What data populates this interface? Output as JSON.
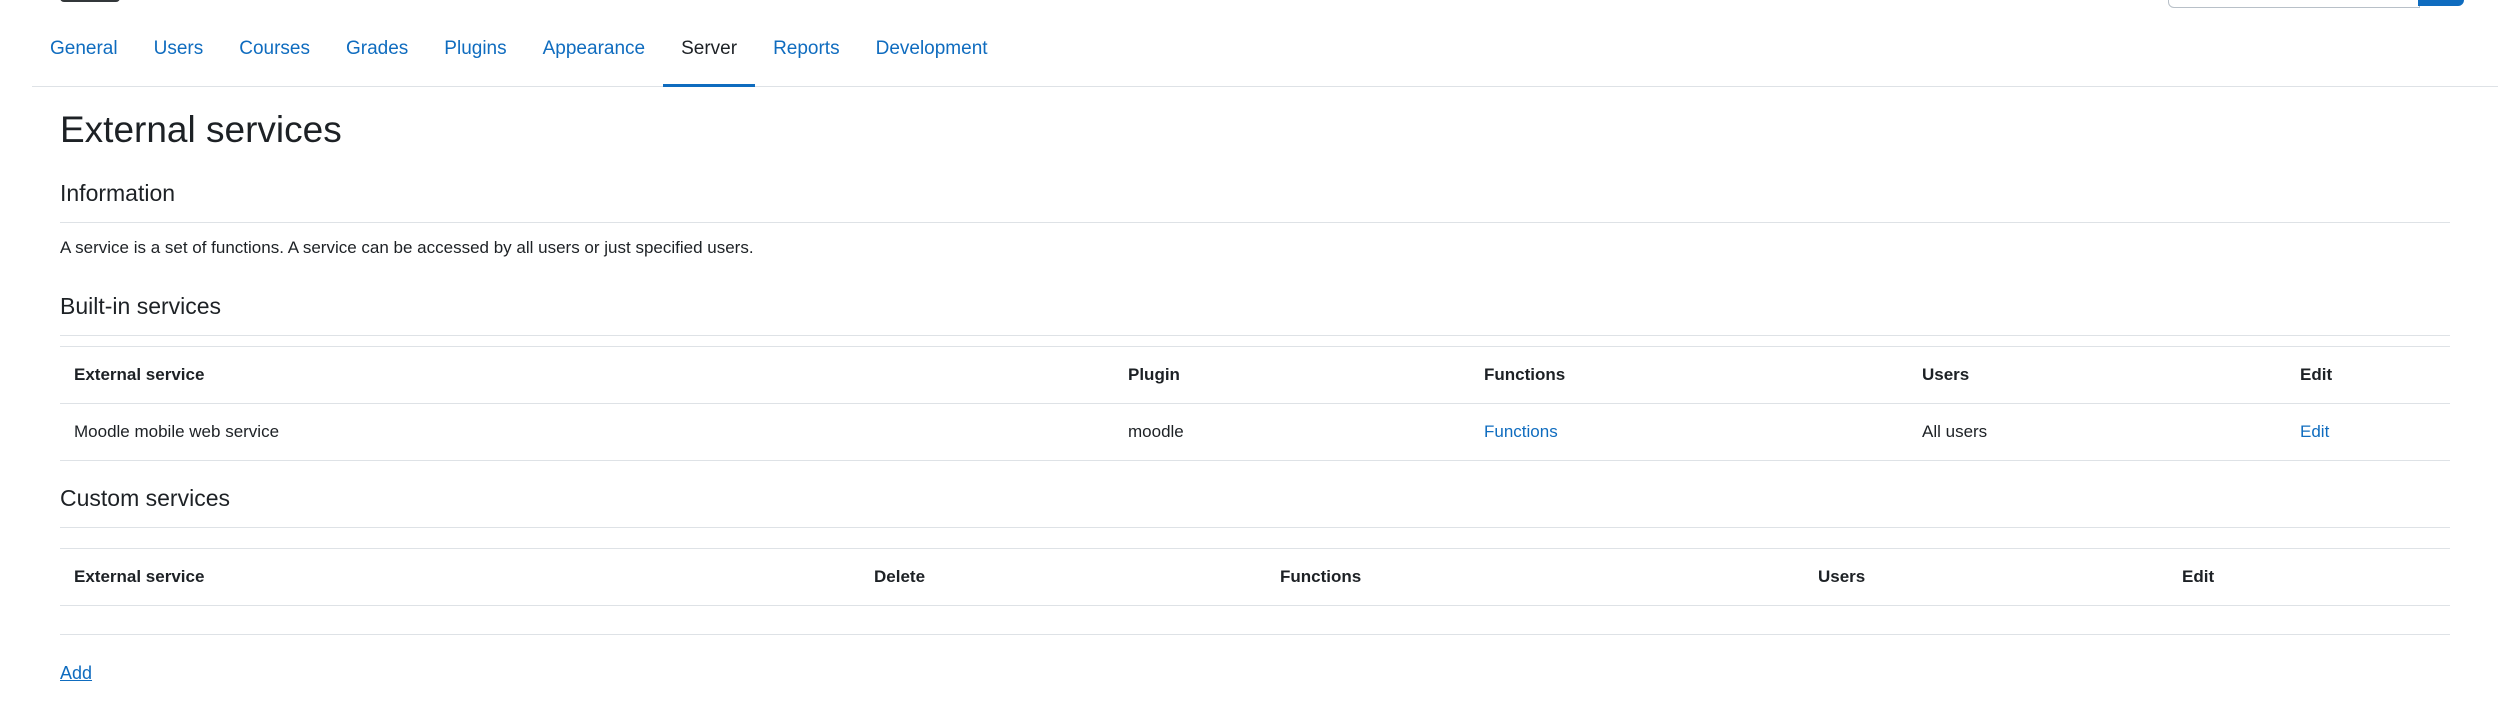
{
  "tabs": [
    {
      "label": "General"
    },
    {
      "label": "Users"
    },
    {
      "label": "Courses"
    },
    {
      "label": "Grades"
    },
    {
      "label": "Plugins"
    },
    {
      "label": "Appearance"
    },
    {
      "label": "Server",
      "active": true
    },
    {
      "label": "Reports"
    },
    {
      "label": "Development"
    }
  ],
  "page": {
    "title": "External services"
  },
  "information": {
    "title": "Information",
    "text": "A service is a set of functions. A service can be accessed by all users or just specified users."
  },
  "builtin": {
    "title": "Built-in services",
    "headers": [
      "External service",
      "Plugin",
      "Functions",
      "Users",
      "Edit"
    ],
    "rows": [
      {
        "service": "Moodle mobile web service",
        "plugin": "moodle",
        "functions": "Functions",
        "users": "All users",
        "edit": "Edit"
      }
    ]
  },
  "custom": {
    "title": "Custom services",
    "headers": [
      "External service",
      "Delete",
      "Functions",
      "Users",
      "Edit"
    ],
    "add_label": "Add"
  },
  "colors": {
    "link": "#0f6cbf",
    "text": "#1d2125",
    "border": "#dee2e6"
  }
}
